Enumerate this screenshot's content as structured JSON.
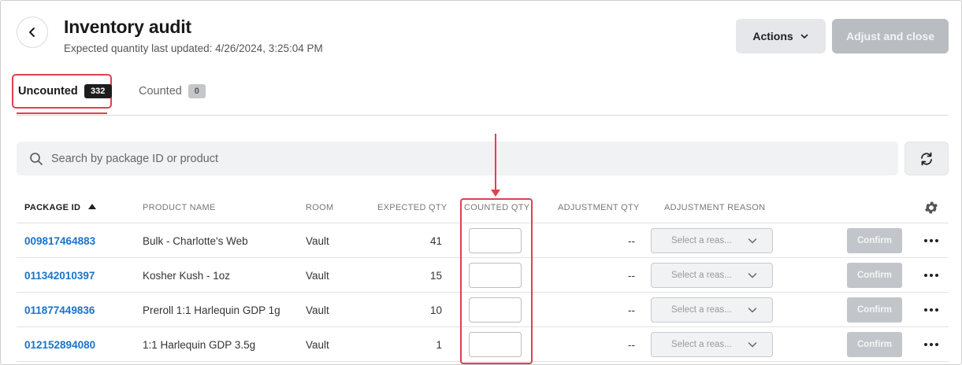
{
  "header": {
    "title": "Inventory audit",
    "subtitle": "Expected quantity last updated: 4/26/2024, 3:25:04 PM",
    "actions_label": "Actions",
    "adjust_label": "Adjust and close"
  },
  "tabs": [
    {
      "label": "Uncounted",
      "count": "332"
    },
    {
      "label": "Counted",
      "count": "0"
    }
  ],
  "search": {
    "placeholder": "Search by package ID or product"
  },
  "table": {
    "columns": {
      "package_id": "PACKAGE ID",
      "product_name": "PRODUCT NAME",
      "room": "ROOM",
      "expected_qty": "EXPECTED QTY",
      "counted_qty": "COUNTED QTY",
      "adjustment_qty": "ADJUSTMENT QTY",
      "adjustment_reason": "ADJUSTMENT REASON"
    },
    "reason_placeholder": "Select a reas...",
    "confirm_label": "Confirm",
    "rows": [
      {
        "package_id": "009817464883",
        "product": "Bulk - Charlotte's Web",
        "room": "Vault",
        "expected": "41",
        "adjustment": "--"
      },
      {
        "package_id": "011342010397",
        "product": "Kosher Kush - 1oz",
        "room": "Vault",
        "expected": "15",
        "adjustment": "--"
      },
      {
        "package_id": "011877449836",
        "product": "Preroll 1:1 Harlequin GDP 1g",
        "room": "Vault",
        "expected": "10",
        "adjustment": "--"
      },
      {
        "package_id": "012152894080",
        "product": "1:1 Harlequin GDP 3.5g",
        "room": "Vault",
        "expected": "1",
        "adjustment": "--"
      }
    ]
  },
  "icons": {
    "back": "chevron-left-icon",
    "actions_caret": "chevron-down-icon",
    "search": "search-icon",
    "refresh": "refresh-icon",
    "settings": "gear-icon",
    "more": "more-horizontal-icon"
  },
  "colors": {
    "accent_red": "#e0404f",
    "link_blue": "#1a73c9",
    "badge_dark": "#1d1d1d"
  }
}
